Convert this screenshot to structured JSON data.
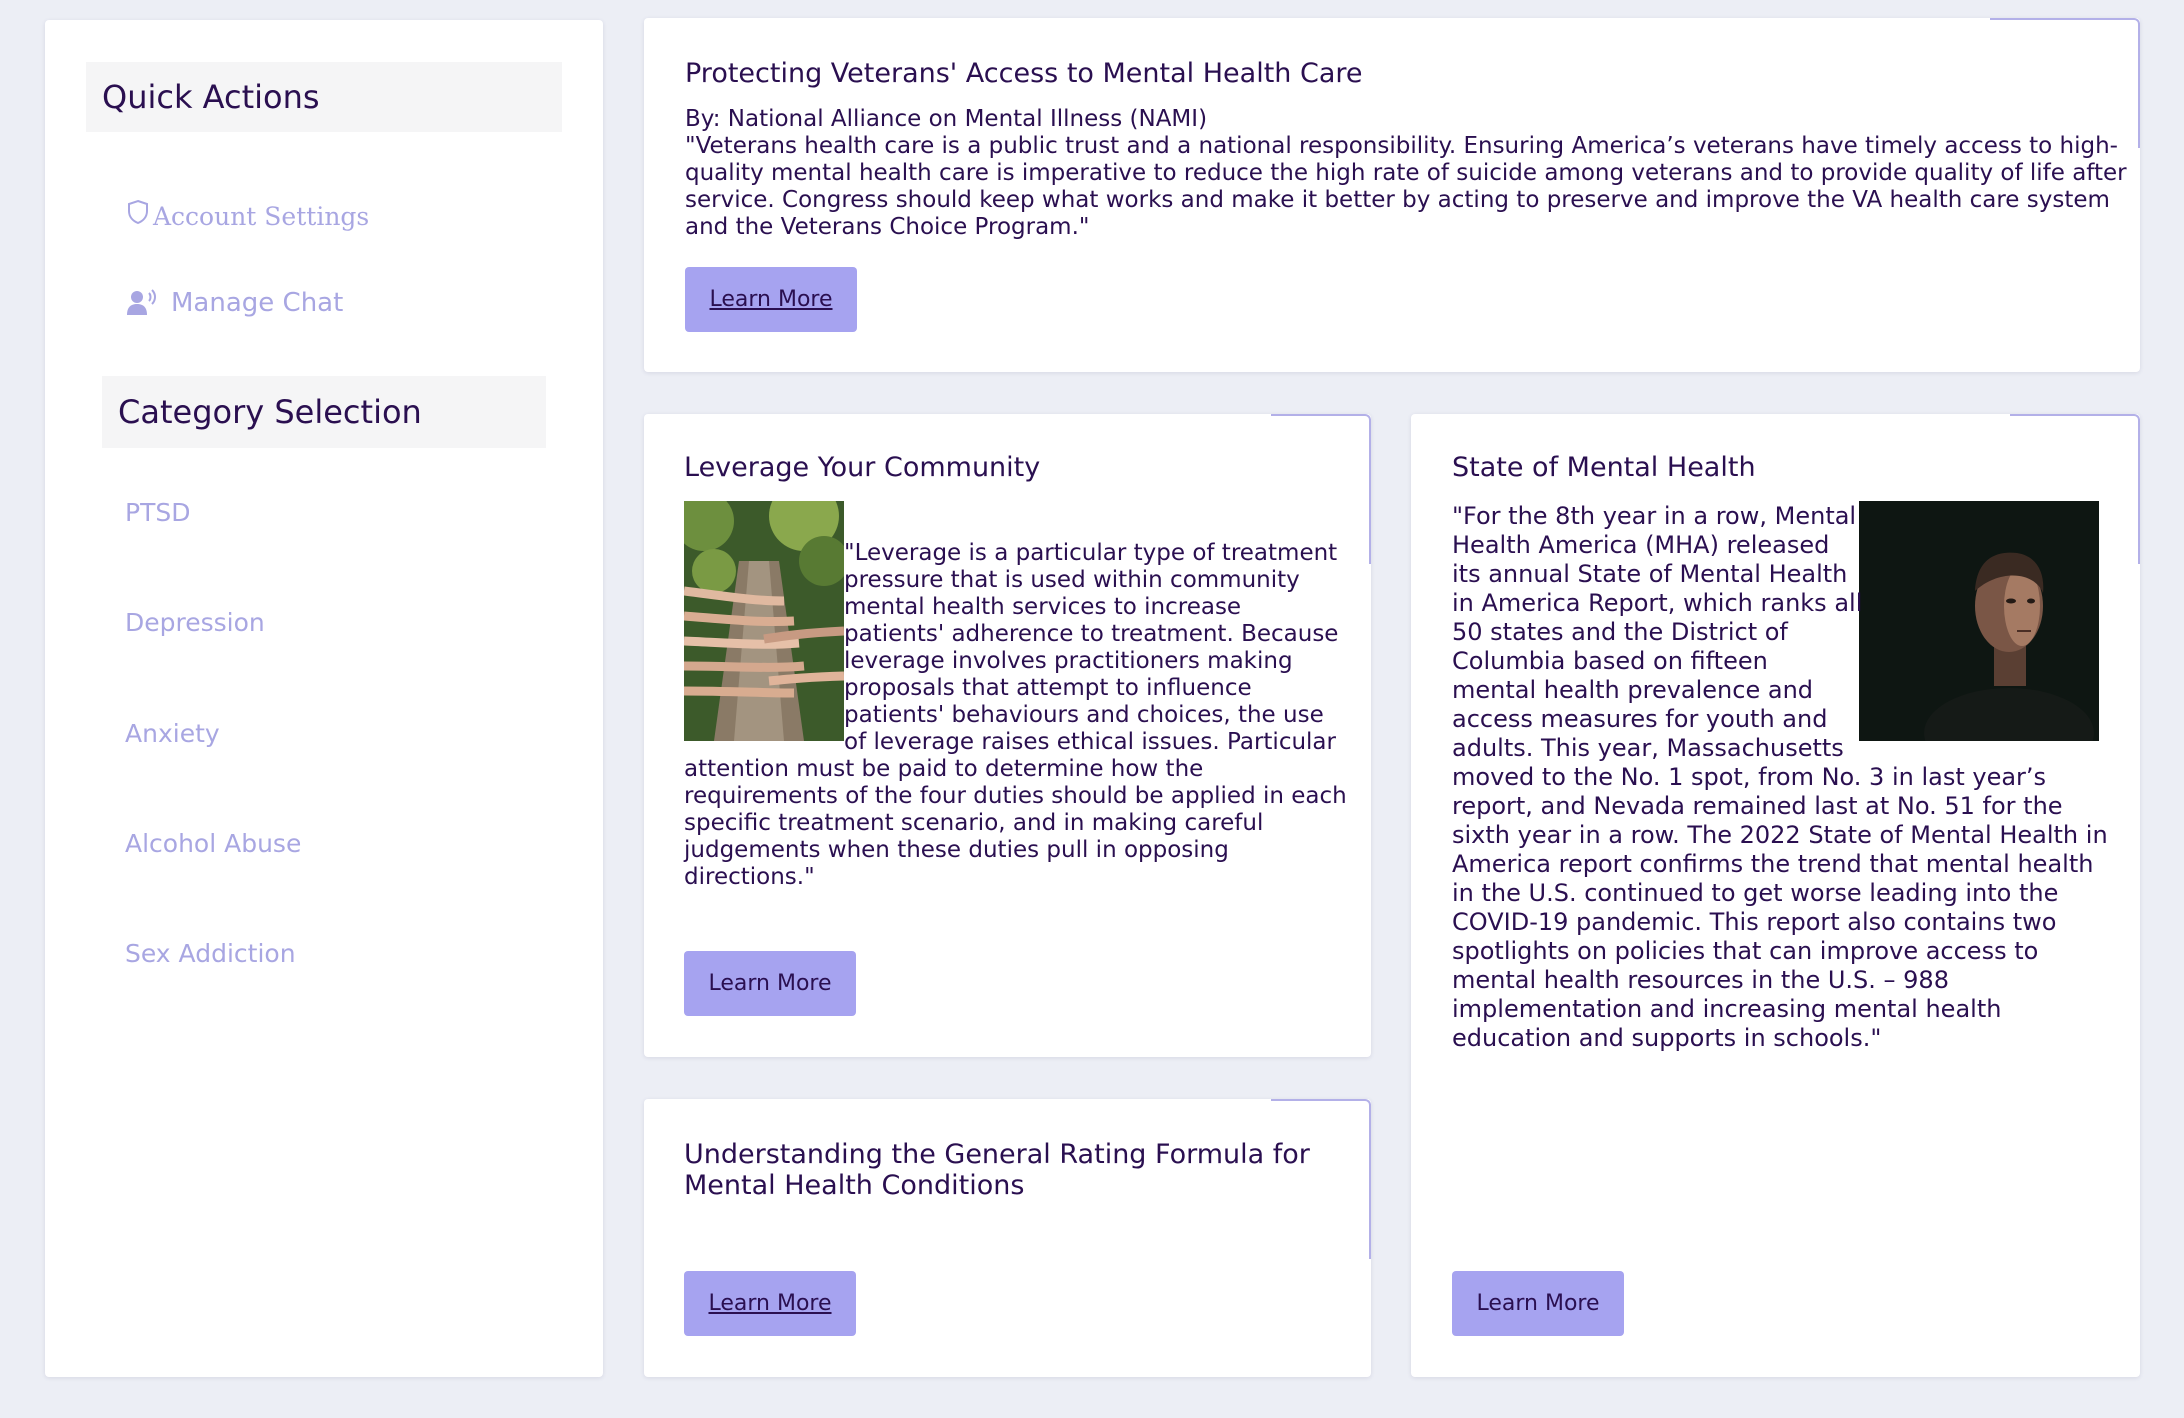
{
  "sidebar": {
    "quick_actions_heading": "Quick Actions",
    "account_settings_label": "Account Settings",
    "manage_chat_label": "Manage Chat",
    "category_heading": "Category Selection",
    "categories": [
      "PTSD",
      "Depression",
      "Anxiety",
      "Alcohol Abuse",
      "Sex Addiction"
    ]
  },
  "cards": {
    "veterans": {
      "title": "Protecting Veterans' Access to Mental Health Care",
      "byline": "By: National Alliance on Mental Illness (NAMI)",
      "quote_lines": [
        "\"Veterans health care is a public trust and a national responsibility. Ensuring America’s veterans have timely access to high-",
        "quality mental health care is imperative to reduce the high rate of suicide among veterans and to provide quality of life after",
        "service. Congress should keep what works and make it better by acting to preserve and improve the VA health care system",
        "and the Veterans Choice Program.\""
      ],
      "button_label": "Learn More"
    },
    "community": {
      "title": "Leverage Your Community",
      "side_lines": [
        "\"Leverage is a particular type of treatment",
        "pressure that is used within community",
        "mental health services to increase",
        "patients' adherence to treatment. Because",
        "leverage involves practitioners making",
        "proposals that attempt to influence",
        "patients' behaviours and choices, the use",
        "of leverage raises ethical issues. Particular"
      ],
      "full_lines": [
        "attention must be paid to determine how the",
        "requirements of the four duties should be applied in each",
        "specific treatment scenario, and in making careful",
        "judgements when these duties pull in opposing",
        "directions.\""
      ],
      "button_label": "Learn More"
    },
    "rating": {
      "title_lines": [
        "Understanding the General Rating Formula for",
        "Mental Health Conditions"
      ],
      "button_label": "Learn More"
    },
    "state": {
      "title": "State of Mental Health",
      "side_lines": [
        "\"For the 8th year in a row, Mental",
        "Health America (MHA) released",
        "its annual State of Mental Health",
        "in America Report, which ranks all",
        "50 states and the District of",
        "Columbia based on fifteen",
        "mental health prevalence and",
        "access measures for youth and",
        "adults. This year, Massachusetts"
      ],
      "full_lines": [
        "moved to the No. 1 spot, from No. 3 in last year’s",
        "report, and Nevada remained last at No. 51 for the",
        "sixth year in a row. The 2022 State of Mental Health in",
        "America report confirms the trend that mental health",
        "in the U.S. continued to get worse leading into the",
        "COVID-19 pandemic. This report also contains two",
        "spotlights on policies that can improve access to",
        "mental health resources in the U.S. – 988",
        "implementation and increasing mental health",
        "education and supports in schools.\""
      ],
      "button_label": "Learn More"
    }
  },
  "icons": {
    "account": "shield-icon",
    "chat": "user-voice-icon"
  },
  "colors": {
    "accent": "#a6a3f0",
    "text_dark": "#2a0f50",
    "link_muted": "#a8a6e2",
    "background": "#eceef5"
  }
}
